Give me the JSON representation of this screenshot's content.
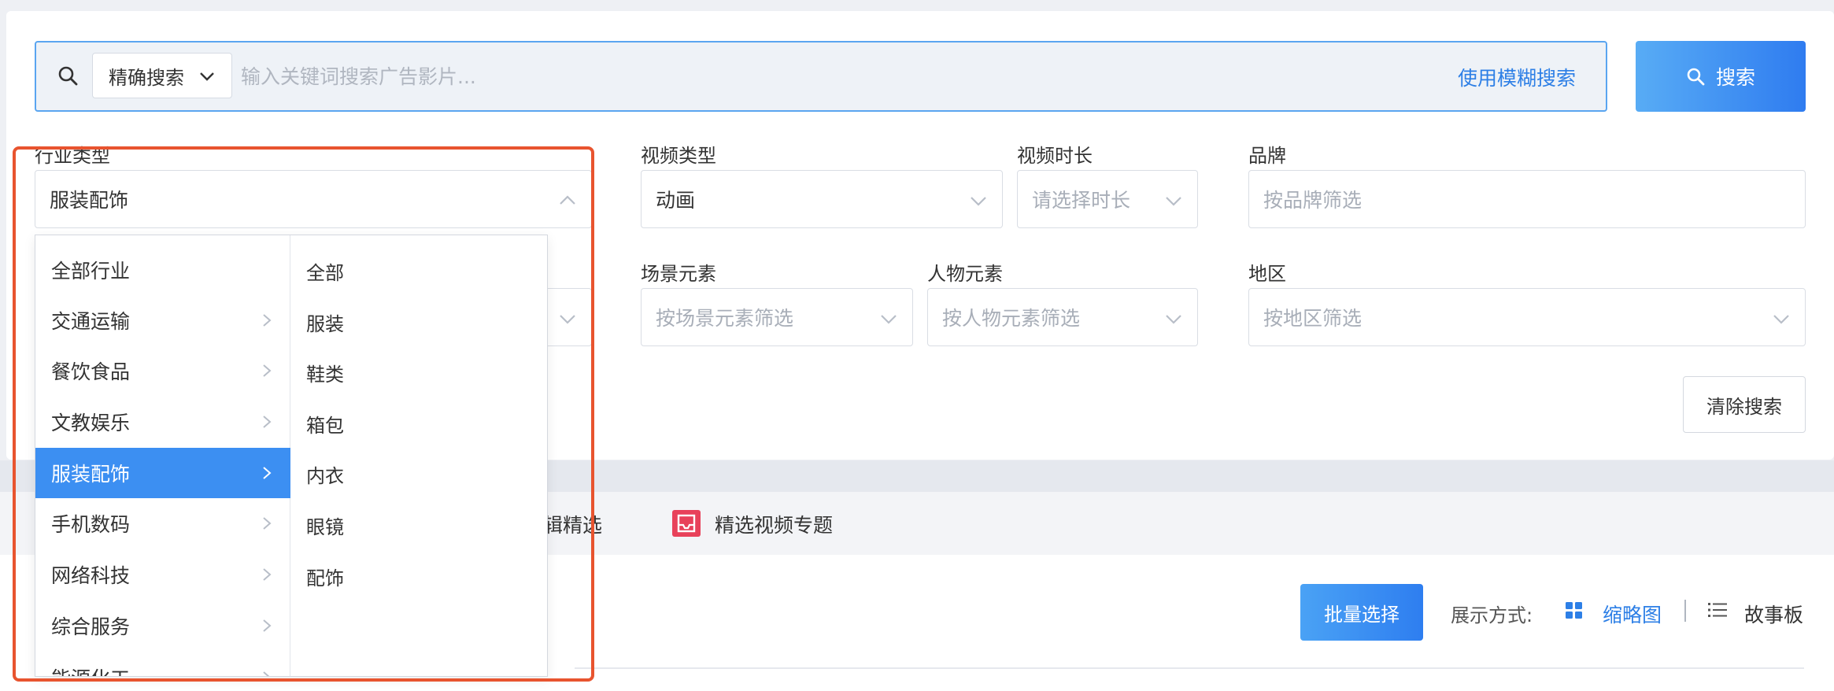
{
  "search": {
    "mode_label": "精确搜索",
    "placeholder": "输入关键词搜索广告影片...",
    "fuzzy_link": "使用模糊搜索",
    "button_label": "搜索"
  },
  "filters": {
    "industry": {
      "label": "行业类型",
      "value": "服装配饰"
    },
    "video_type": {
      "label": "视频类型",
      "value": "动画"
    },
    "duration": {
      "label": "视频时长",
      "placeholder": "请选择时长"
    },
    "brand": {
      "label": "品牌",
      "placeholder": "按品牌筛选"
    },
    "scene": {
      "label": "场景元素",
      "placeholder": "按场景元素筛选"
    },
    "person": {
      "label": "人物元素",
      "placeholder": "按人物元素筛选"
    },
    "region": {
      "label": "地区",
      "placeholder": "按地区筛选"
    },
    "clear_button": "清除搜索"
  },
  "cascader": {
    "industries": [
      {
        "label": "全部行业",
        "has_children": false,
        "active": false
      },
      {
        "label": "交通运输",
        "has_children": true,
        "active": false
      },
      {
        "label": "餐饮食品",
        "has_children": true,
        "active": false
      },
      {
        "label": "文教娱乐",
        "has_children": true,
        "active": false
      },
      {
        "label": "服装配饰",
        "has_children": true,
        "active": true
      },
      {
        "label": "手机数码",
        "has_children": true,
        "active": false
      },
      {
        "label": "网络科技",
        "has_children": true,
        "active": false
      },
      {
        "label": "综合服务",
        "has_children": true,
        "active": false
      },
      {
        "label": "能源化工",
        "has_children": true,
        "active": false
      }
    ],
    "subcategories": [
      "全部",
      "服装",
      "鞋类",
      "箱包",
      "内衣",
      "眼镜",
      "配饰"
    ]
  },
  "tabs": {
    "partial_tab": "辑精选",
    "topic_tab": "精选视频专题"
  },
  "toolbar": {
    "batch_select": "批量选择",
    "view_label": "展示方式:",
    "thumbnail": "缩略图",
    "storyboard": "故事板"
  },
  "colors": {
    "accent": "#2d7fe6",
    "active_item": "#3c8ff2",
    "highlight_frame": "#e8542f",
    "topic_icon": "#e8415a"
  }
}
